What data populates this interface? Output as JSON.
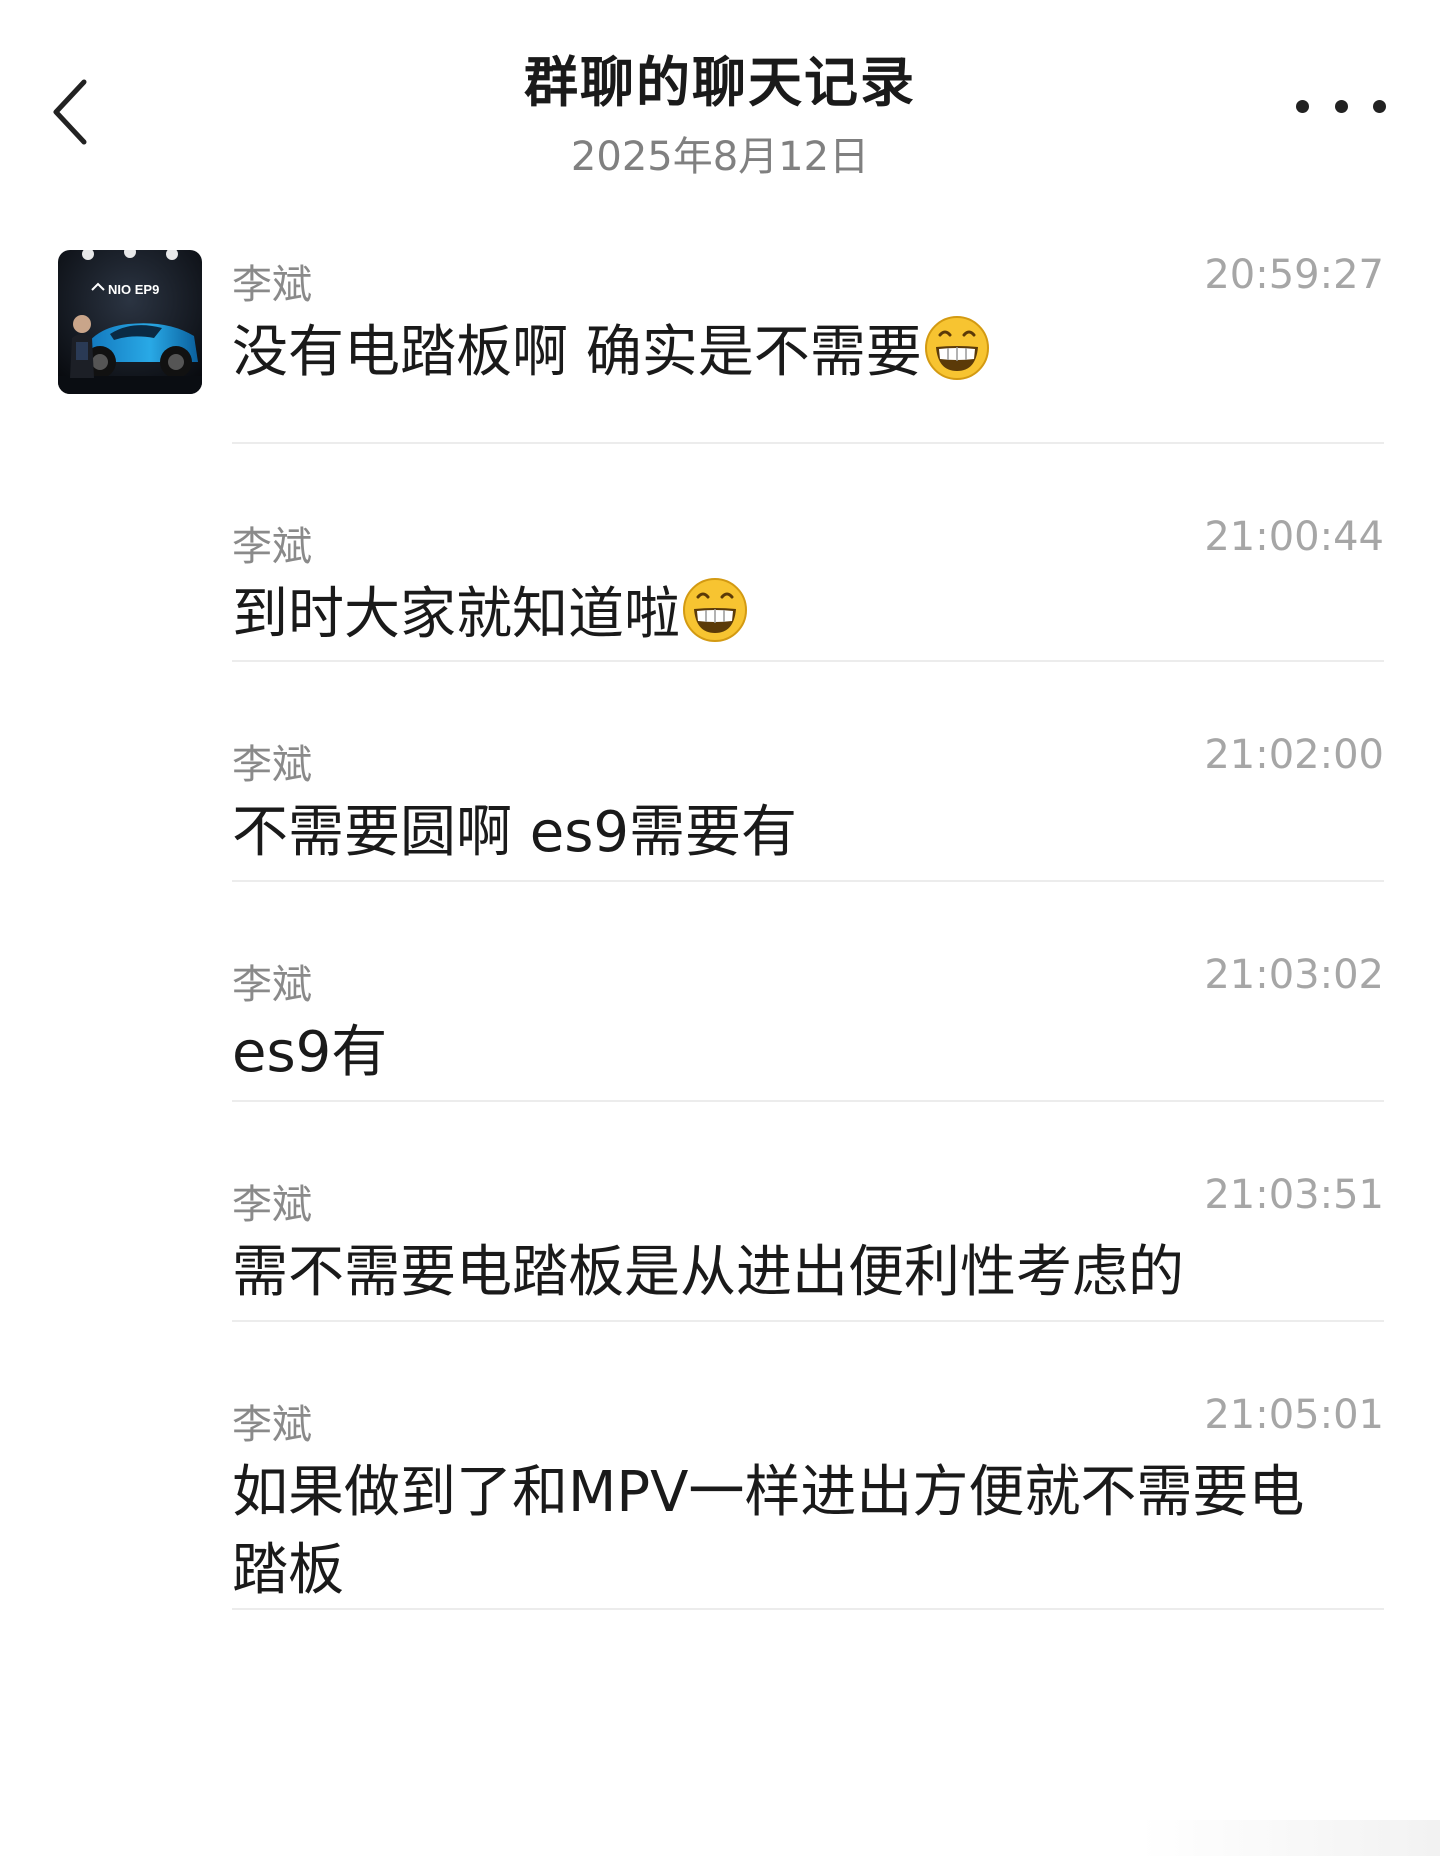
{
  "header": {
    "title": "群聊的聊天记录",
    "subtitle": "2025年8月12日",
    "back_icon": "chevron-left-icon",
    "more_icon": "more-horizontal-icon"
  },
  "avatar": {
    "logo_text": "NIO EP9",
    "icon": "avatar-image"
  },
  "emoji": {
    "name": "grinning-face-emoji",
    "color": "#f7c431"
  },
  "messages": [
    {
      "sender": "李斌",
      "time": "20:59:27",
      "text": "没有电踏板啊 确实是不需要",
      "emoji": true
    },
    {
      "sender": "李斌",
      "time": "21:00:44",
      "text": "到时大家就知道啦",
      "emoji": true
    },
    {
      "sender": "李斌",
      "time": "21:02:00",
      "text": "不需要圆啊 es9需要有",
      "emoji": false
    },
    {
      "sender": "李斌",
      "time": "21:03:02",
      "text": "es9有",
      "emoji": false
    },
    {
      "sender": "李斌",
      "time": "21:03:51",
      "text": "需不需要电踏板是从进出便利性考虑的",
      "emoji": false
    },
    {
      "sender": "李斌",
      "time": "21:05:01",
      "text": "如果做到了和MPV一样进出方便就不需要电踏板",
      "emoji": false
    }
  ]
}
